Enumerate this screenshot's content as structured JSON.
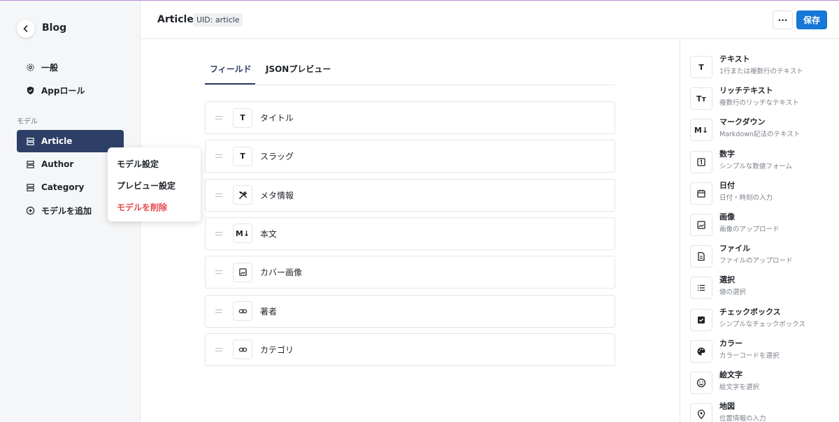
{
  "sidebar": {
    "title": "Blog",
    "general_label": "一般",
    "app_role_label": "Appロール",
    "section_label": "モデル",
    "models": [
      {
        "label": "Article"
      },
      {
        "label": "Author"
      },
      {
        "label": "Category"
      }
    ],
    "add_model_label": "モデルを追加"
  },
  "context_menu": {
    "items": [
      "モデル設定",
      "プレビュー設定",
      "モデルを削除"
    ]
  },
  "header": {
    "title": "Article",
    "uid": "UID: article",
    "more_label": "···",
    "save_label": "保存"
  },
  "tabs": {
    "fields": "フィールド",
    "json_preview": "JSONプレビュー"
  },
  "fields": [
    {
      "icon": "text-icon",
      "glyph": "T",
      "label": "タイトル"
    },
    {
      "icon": "text-icon",
      "glyph": "T",
      "label": "スラッグ"
    },
    {
      "icon": "tools-icon",
      "glyph": "",
      "label": "メタ情報"
    },
    {
      "icon": "markdown-icon",
      "glyph": "M↓",
      "label": "本文"
    },
    {
      "icon": "image-icon",
      "glyph": "",
      "label": "カバー画像"
    },
    {
      "icon": "link-icon",
      "glyph": "",
      "label": "著者"
    },
    {
      "icon": "link-icon",
      "glyph": "",
      "label": "カテゴリ"
    }
  ],
  "palette": [
    {
      "icon": "text-icon",
      "glyph": "T",
      "name": "テキスト",
      "desc": "1行または複数行のテキスト"
    },
    {
      "icon": "rich-text-icon",
      "glyph": "Tт",
      "name": "リッチテキスト",
      "desc": "複数行のリッチなテキスト"
    },
    {
      "icon": "markdown-icon",
      "glyph": "M↓",
      "name": "マークダウン",
      "desc": "Markdown記法のテキスト"
    },
    {
      "icon": "number-icon",
      "glyph": "1",
      "name": "数字",
      "desc": "シンプルな数値フォーム"
    },
    {
      "icon": "calendar-icon",
      "glyph": "",
      "name": "日付",
      "desc": "日付・時刻の入力"
    },
    {
      "icon": "image-icon",
      "glyph": "",
      "name": "画像",
      "desc": "画像のアップロード"
    },
    {
      "icon": "file-icon",
      "glyph": "",
      "name": "ファイル",
      "desc": "ファイルのアップロード"
    },
    {
      "icon": "list-icon",
      "glyph": "",
      "name": "選択",
      "desc": "値の選択"
    },
    {
      "icon": "checkbox-icon",
      "glyph": "",
      "name": "チェックボックス",
      "desc": "シンプルなチェックボックス"
    },
    {
      "icon": "palette-icon",
      "glyph": "",
      "name": "カラー",
      "desc": "カラーコードを選択"
    },
    {
      "icon": "emoji-icon",
      "glyph": "",
      "name": "絵文字",
      "desc": "絵文字を選択"
    },
    {
      "icon": "map-pin-icon",
      "glyph": "",
      "name": "地図",
      "desc": "位置情報の入力"
    }
  ],
  "colors": {
    "accent": "#2d3f66",
    "save": "#1677d6",
    "danger": "#e5484d",
    "sidebar_bg": "#f5f6f7"
  }
}
